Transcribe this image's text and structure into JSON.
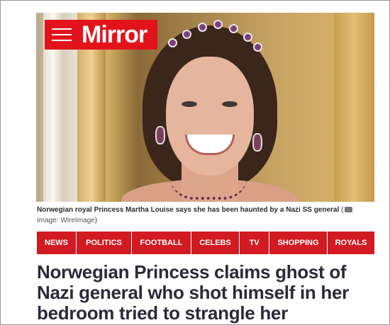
{
  "brand": {
    "logo_text": "Mirror",
    "accent_color": "#e3131c",
    "nav_color": "#d11a22"
  },
  "image": {
    "caption": "Norwegian royal Princess Martha Louise says she has been haunted by a Nazi SS general",
    "credit_label": "Image:",
    "credit": "WireImage"
  },
  "nav": {
    "items": [
      {
        "label": "NEWS"
      },
      {
        "label": "POLITICS"
      },
      {
        "label": "FOOTBALL"
      },
      {
        "label": "CELEBS"
      },
      {
        "label": "TV"
      },
      {
        "label": "SHOPPING"
      },
      {
        "label": "ROYALS"
      }
    ]
  },
  "article": {
    "headline": "Norwegian Princess claims ghost of Nazi general who shot himself in her bedroom tried to strangle her"
  }
}
